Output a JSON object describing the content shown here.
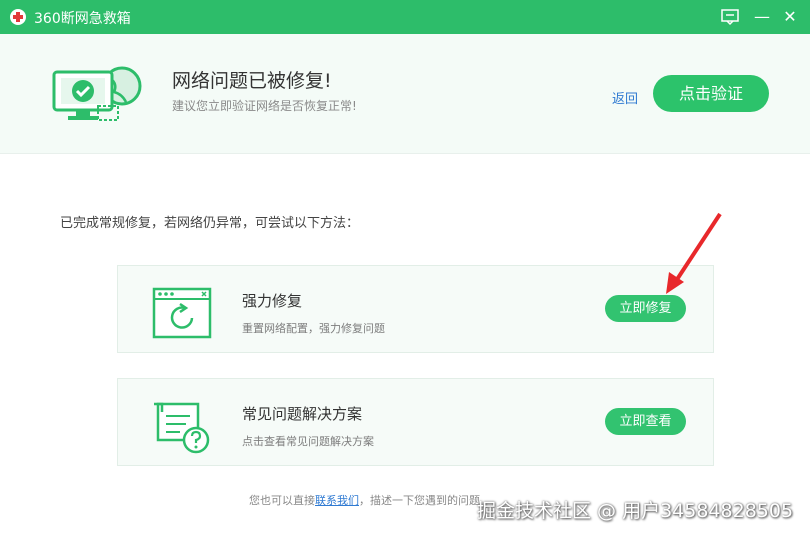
{
  "window": {
    "title": "360断网急救箱",
    "feedback_icon": "feedback-icon",
    "minimize_glyph": "—",
    "close_glyph": "✕"
  },
  "status": {
    "title": "网络问题已被修复!",
    "subtitle": "建议您立即验证网络是否恢复正常!",
    "back_label": "返回",
    "verify_label": "点击验证"
  },
  "intro": "已完成常规修复，若网络仍异常，可尝试以下方法：",
  "options": [
    {
      "title": "强力修复",
      "desc": "重置网络配置，强力修复问题",
      "button": "立即修复",
      "icon": "browser-repair-icon"
    },
    {
      "title": "常见问题解决方案",
      "desc": "点击查看常见问题解决方案",
      "button": "立即查看",
      "icon": "faq-document-icon"
    }
  ],
  "footer": {
    "prefix": "您也可以直接",
    "link": "联系我们",
    "suffix": "，描述一下您遇到的问题"
  },
  "watermark": "掘金技术社区 @ 用户34584828505",
  "colors": {
    "brand_green": "#2dbd6a",
    "button_green": "#2cc36b",
    "link_blue": "#2f7ad2",
    "annotation_red": "#e8282b"
  }
}
